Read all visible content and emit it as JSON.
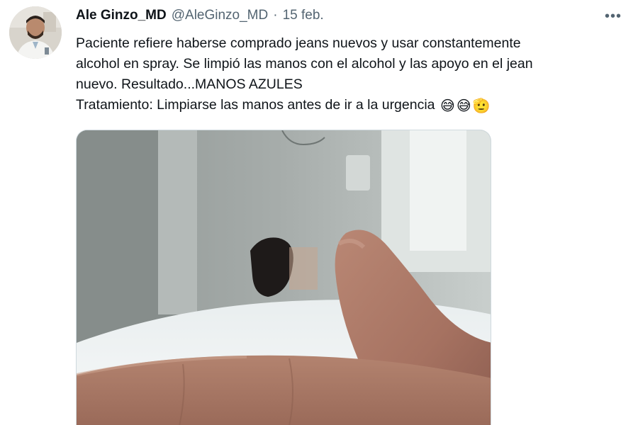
{
  "tweet": {
    "author_name": "Ale Ginzo_MD",
    "author_handle": "@AleGinzo_MD",
    "separator": "·",
    "date": "15 feb.",
    "more_icon": "•••",
    "text_lines": [
      "Paciente refiere haberse comprado jeans nuevos y usar constantemente",
      "alcohol en spray. Se limpió las manos con el alcohol y las apoyo en el jean",
      "nuevo. Resultado...MANOS AZULES",
      "Tratamiento: Limpiarse las manos antes de ir a la urgencia"
    ],
    "emojis": [
      "😅",
      "😅",
      "🫡"
    ],
    "icons": {
      "more": "more-horizontal-icon"
    }
  }
}
